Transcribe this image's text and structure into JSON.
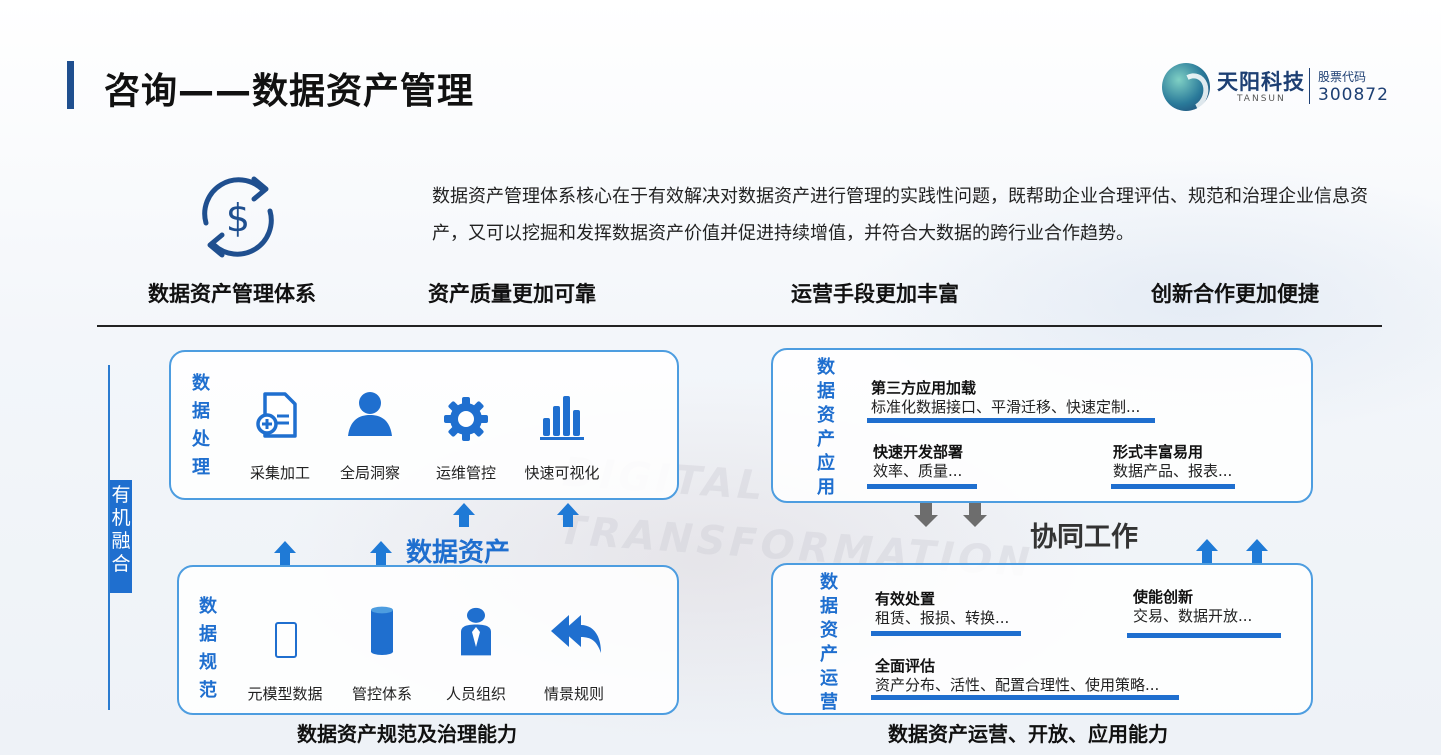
{
  "title": "咨询——数据资产管理",
  "brand": {
    "name_cn": "天阳科技",
    "name_en": "TANSUN",
    "stock_label": "股票代码",
    "stock_code": "300872"
  },
  "intro": "数据资产管理体系核心在于有效解决对数据资产进行管理的实践性问题，既帮助企业合理评估、规范和治理企业信息资产，又可以挖掘和发挥数据资产价值并促进持续增值，并符合大数据的跨行业合作趋势。",
  "pillars": [
    "数据资产管理体系",
    "资产质量更加可靠",
    "运营手段更加丰富",
    "创新合作更加便捷"
  ],
  "left_side_label": "有机融合",
  "processing": {
    "title": "数据处理",
    "items": [
      {
        "label": "采集加工",
        "icon": "document-add-icon"
      },
      {
        "label": "全局洞察",
        "icon": "user-icon"
      },
      {
        "label": "运维管控",
        "icon": "gear-icon"
      },
      {
        "label": "快速可视化",
        "icon": "bar-chart-icon"
      }
    ]
  },
  "center_label": "数据资产",
  "standard": {
    "title": "数据规范",
    "items": [
      {
        "label": "元模型数据",
        "icon": "rectangle-icon"
      },
      {
        "label": "管控体系",
        "icon": "cylinder-icon"
      },
      {
        "label": "人员组织",
        "icon": "person-tie-icon"
      },
      {
        "label": "情景规则",
        "icon": "reply-all-icon"
      }
    ]
  },
  "left_caption": "数据资产规范及治理能力",
  "application": {
    "title": "数据资产应用",
    "features": [
      {
        "title": "第三方应用加载",
        "desc": "标准化数据接口、平滑迁移、快速定制..."
      },
      {
        "title": "快速开发部署",
        "desc": "效率、质量..."
      },
      {
        "title": "形式丰富易用",
        "desc": "数据产品、报表..."
      }
    ]
  },
  "collab_label": "协同工作",
  "operation": {
    "title": "数据资产运营",
    "features": [
      {
        "title": "有效处置",
        "desc": "租赁、报损、转换..."
      },
      {
        "title": "使能创新",
        "desc": "交易、数据开放..."
      },
      {
        "title": "全面评估",
        "desc": "资产分布、活性、配置合理性、使用策略..."
      }
    ]
  },
  "right_caption": "数据资产运营、开放、应用能力",
  "colors": {
    "accent": "#1f6fcf",
    "title_bar": "#1f4f8f",
    "brand": "#1d3f73",
    "arrow_gray": "#6d6d6d"
  }
}
